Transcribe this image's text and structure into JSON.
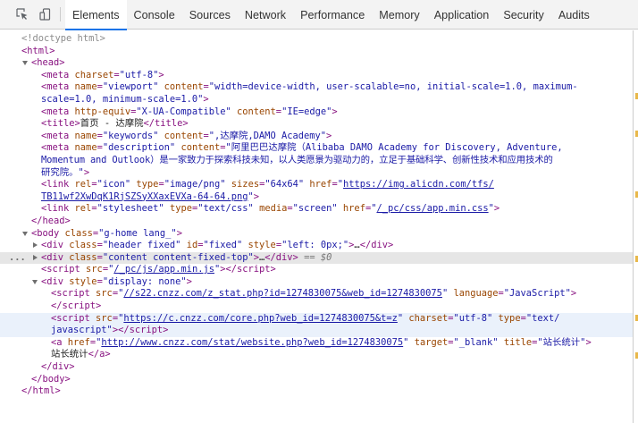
{
  "toolbar": {
    "inspect_icon": "inspect-cursor-icon",
    "device_icon": "device-mode-icon",
    "tabs": [
      {
        "label": "Elements",
        "active": true
      },
      {
        "label": "Console"
      },
      {
        "label": "Sources"
      },
      {
        "label": "Network"
      },
      {
        "label": "Performance"
      },
      {
        "label": "Memory"
      },
      {
        "label": "Application"
      },
      {
        "label": "Security"
      },
      {
        "label": "Audits"
      }
    ]
  },
  "colors": {
    "tag": "#881280",
    "attr_name": "#994500",
    "attr_value": "#1a1aa6",
    "accent": "#1a73e8"
  },
  "tree": {
    "doctype": "<!doctype html>",
    "html_open": "<html>",
    "head_open": "<head>",
    "meta_charset": {
      "name": "charset",
      "value": "\"utf-8\""
    },
    "meta_viewport": {
      "attr1_name": "name",
      "attr1_value": "\"viewport\"",
      "attr2_name": "content",
      "attr2_value_1": "\"width=device-width, user-scalable=no, initial-scale=1.0, maximum-",
      "attr2_value_2": "scale=1.0, minimum-scale=1.0\""
    },
    "meta_compat": {
      "attr1_name": "http-equiv",
      "attr1_value": "\"X-UA-Compatible\"",
      "attr2_name": "content",
      "attr2_value": "\"IE=edge\""
    },
    "title_text": "首页 - 达摩院",
    "meta_keywords": {
      "attr1_name": "name",
      "attr1_value": "\"keywords\"",
      "attr2_name": "content",
      "attr2_value": "\",达摩院,DAMO Academy\""
    },
    "meta_description": {
      "attr1_name": "name",
      "attr1_value": "\"description\"",
      "attr2_name": "content",
      "value_1": "\"阿里巴巴达摩院（Alibaba DAMO Academy for Discovery, Adventure,",
      "value_2": "Momentum and Outlook）是一家致力于探索科技未知，以人类愿景为驱动力的，立足于基础科学、创新性技术和应用技术的",
      "value_3": "研究院。\""
    },
    "link_icon": {
      "a1n": "rel",
      "a1v": "\"icon\"",
      "a2n": "type",
      "a2v": "\"image/png\"",
      "a3n": "sizes",
      "a3v": "\"64x64\"",
      "a4n": "href",
      "url_1": "https://img.alicdn.com/tfs/",
      "url_2": "TB11wf2XwDqK1RjSZSyXXaxEVXa-64-64.png"
    },
    "link_css": {
      "a1n": "rel",
      "a1v": "\"stylesheet\"",
      "a2n": "type",
      "a2v": "\"text/css\"",
      "a3n": "media",
      "a3v": "\"screen\"",
      "a4n": "href",
      "url": "/_pc/css/app.min.css"
    },
    "head_close": "</head>",
    "body": {
      "attr_name": "class",
      "attr_value": "\"g-home lang_\""
    },
    "div_header": {
      "a1n": "class",
      "a1v": "\"header fixed\"",
      "a2n": "id",
      "a2v": "\"fixed\"",
      "a3n": "style",
      "a3v": "\"left: 0px;\""
    },
    "div_content": {
      "a1n": "class",
      "a1v": "\"content content-fixed-top\"",
      "selected_marker": "== $0"
    },
    "script_app": {
      "a1n": "src",
      "url": "/_pc/js/app.min.js"
    },
    "div_hidden": {
      "a1n": "style",
      "a1v": "\"display: none\""
    },
    "script_stat": {
      "a1n": "src",
      "url": "//s22.cnzz.com/z_stat.php?id=1274830075&web_id=1274830075",
      "a2n": "language",
      "a2v": "\"JavaScript\""
    },
    "script_core": {
      "a1n": "src",
      "url": "https://c.cnzz.com/core.php?web_id=1274830075&t=z",
      "a2n": "charset",
      "a2v": "\"utf-8\"",
      "a3n": "type",
      "a3v_1": "\"text/",
      "a3v_2": "javascript\""
    },
    "a_stat": {
      "a1n": "href",
      "url": "http://www.cnzz.com/stat/website.php?web_id=1274830075",
      "a2n": "target",
      "a2v": "\"_blank\"",
      "a3n": "title",
      "a3v": "\"站长统计\"",
      "text": "站长统计"
    },
    "ellipsis": "…",
    "gutter_dots": "..."
  }
}
